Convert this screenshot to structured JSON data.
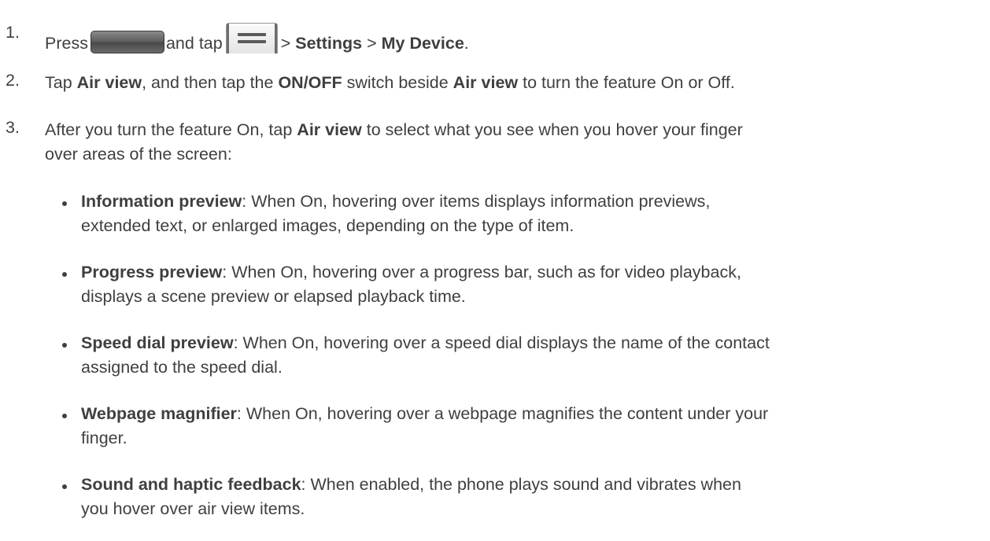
{
  "steps": [
    {
      "number": "1.",
      "press_text": "Press",
      "and_tap_text": "and tap",
      "sep1": ">",
      "settings": "Settings",
      "sep2": ">",
      "my_device": "My Device",
      "end": ".",
      "icons": [
        "home-key-icon",
        "menu-key-icon"
      ]
    },
    {
      "number": "2.",
      "t1": "Tap ",
      "b1": "Air view",
      "t2": ", and then tap the ",
      "b2": "ON/OFF",
      "t3": " switch beside ",
      "b3": "Air view",
      "t4": " to turn the feature On or Off."
    },
    {
      "number": "3.",
      "t1": "After you turn the feature On, tap ",
      "b1": "Air view",
      "t2": " to select what you see when you hover your finger",
      "line2": "over areas of the screen:"
    }
  ],
  "bullets": [
    {
      "title": "Information preview",
      "line1": ": When On, hovering over items displays information previews,",
      "line2": "extended text, or enlarged images, depending on the type of item."
    },
    {
      "title": "Progress preview",
      "line1": ": When On, hovering over a progress bar, such as for video playback,",
      "line2": "displays a scene preview or elapsed playback time."
    },
    {
      "title": "Speed dial preview",
      "line1": ": When On, hovering over a speed dial displays the name of the contact",
      "line2": "assigned to the speed dial."
    },
    {
      "title": "Webpage magnifier",
      "line1": ": When On, hovering over a webpage magnifies the content under your",
      "line2": "finger."
    },
    {
      "title": "Sound and haptic feedback",
      "line1": ": When enabled, the phone plays sound and vibrates when",
      "line2": "you hover over air view items."
    }
  ]
}
